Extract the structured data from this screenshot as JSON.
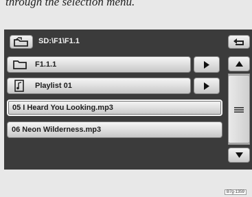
{
  "caption": "through the selection menu.",
  "header": {
    "path": "SD:\\F1\\F1.1"
  },
  "list": {
    "folder_label": "F1.1.1",
    "playlist_label": "Playlist 01",
    "files": [
      "05 I Heard You Looking.mp3",
      "06 Neon Wilderness.mp3"
    ]
  },
  "reference": "B7g-1359"
}
